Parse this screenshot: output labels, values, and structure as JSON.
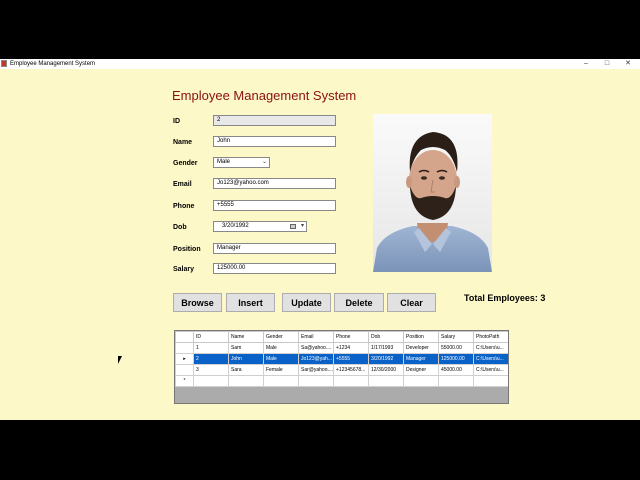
{
  "window": {
    "title": "Employee Management System",
    "controls": {
      "minimize": "–",
      "maximize": "□",
      "close": "✕"
    }
  },
  "heading": "Employee Management System",
  "form": {
    "id": {
      "label": "ID",
      "value": "2"
    },
    "name": {
      "label": "Name",
      "value": "John"
    },
    "gender": {
      "label": "Gender",
      "value": "Male"
    },
    "email": {
      "label": "Email",
      "value": "Jo123@yahoo.com"
    },
    "phone": {
      "label": "Phone",
      "value": "+5555"
    },
    "dob": {
      "label": "Dob",
      "value": "3/20/1992"
    },
    "position": {
      "label": "Position",
      "value": "Manager"
    },
    "salary": {
      "label": "Salary",
      "value": "125000.00"
    }
  },
  "buttons": {
    "browse": "Browse",
    "insert": "Insert",
    "update": "Update",
    "delete": "Delete",
    "clear": "Clear"
  },
  "total_employees": "Total Employees: 3",
  "grid": {
    "columns": [
      "ID",
      "Name",
      "Gender",
      "Email",
      "Phone",
      "Dob",
      "Position",
      "Salary",
      "PhotoPath"
    ],
    "rows": [
      [
        "1",
        "Sam",
        "Male",
        "Sa@yahoo....",
        "+1234",
        "1/17/1993",
        "Developer",
        "55000.00",
        "C:\\Users\\u..."
      ],
      [
        "2",
        "John",
        "Male",
        "Jo123@yah...",
        "+5555",
        "3/20/1992",
        "Manager",
        "125000.00",
        "C:\\Users\\u..."
      ],
      [
        "3",
        "Sara",
        "Female",
        "Sar@yahoo....",
        "+12345678...",
        "12/30/2000",
        "Designer",
        "45000.00",
        "C:\\Users\\u..."
      ]
    ],
    "selected_marker": "▸",
    "new_row_marker": "*"
  },
  "colors": {
    "background": "#fdf8c8",
    "heading": "#8b1010",
    "selection": "#0a62c8"
  },
  "icons": {
    "photo": "employee-photo",
    "gender_dropdown": "chevron-down-icon",
    "dob_picker": "calendar-icon"
  }
}
